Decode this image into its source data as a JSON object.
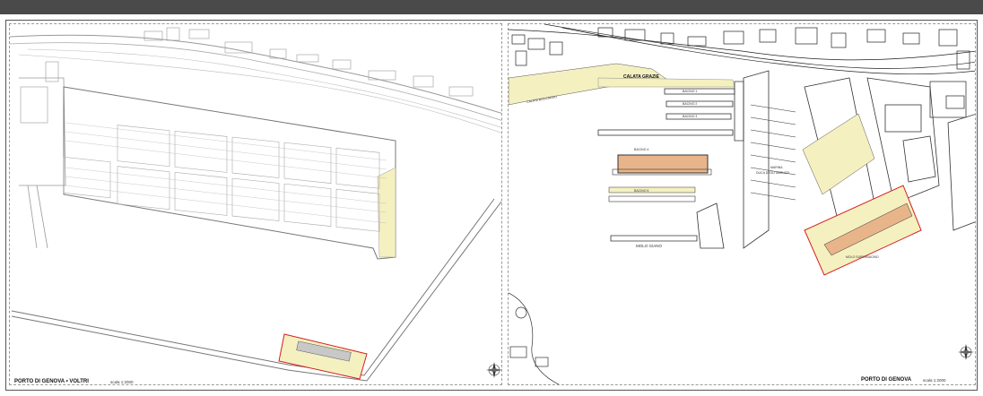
{
  "left_sheet": {
    "title": "PORTO DI GENOVA • VOLTRI",
    "scale": "scala 1:2000"
  },
  "right_sheet": {
    "title": "PORTO DI GENOVA",
    "scale": "scala 1:2000",
    "labels": {
      "calata_grazie": "CALATA GRAZIE",
      "calata_boccardo": "CALATA BOCCARDO",
      "bacino_1": "BACINO 1",
      "bacino_2": "BACINO 2",
      "bacino_3": "BACINO 3",
      "bacino_4": "BACINO 4",
      "bacino_5": "BACINO 5",
      "molo_giano": "MOLO GIANO",
      "marina": "MARINA",
      "duca_degli_abruzzi": "DUCA DEGLI ABRUZZI",
      "molo_superbacino": "MOLO SUPERBACINO"
    }
  },
  "colors": {
    "toolbar": "#4a4a4a",
    "highlight_yellow": "#f5f0c0",
    "highlight_orange": "#e8b48a",
    "red_outline": "#d42020",
    "linework": "#888888"
  }
}
